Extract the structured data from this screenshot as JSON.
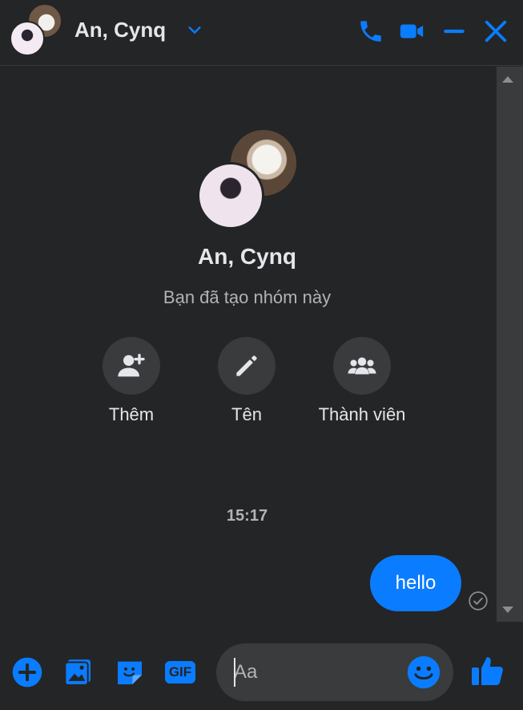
{
  "header": {
    "title": "An, Cynq",
    "icons": [
      "chevron-down-icon",
      "phone-icon",
      "video-icon",
      "minimize-icon",
      "close-icon"
    ],
    "accent_color": "#0a7cff"
  },
  "intro": {
    "group_name": "An, Cynq",
    "subtitle": "Bạn đã tạo nhóm này",
    "actions": [
      {
        "label": "Thêm",
        "icon": "add-person-icon"
      },
      {
        "label": "Tên",
        "icon": "pencil-icon"
      },
      {
        "label": "Thành viên",
        "icon": "group-icon"
      }
    ]
  },
  "messages": {
    "timestamp": "15:17",
    "items": [
      {
        "text": "hello",
        "from": "me",
        "status": "seen-check-icon"
      }
    ]
  },
  "composer": {
    "placeholder": "Aa",
    "value": "",
    "icons": [
      "plus-icon",
      "photo-icon",
      "sticker-icon",
      "gif-icon",
      "emoji-icon",
      "like-icon"
    ],
    "gif_label": "GIF"
  },
  "colors": {
    "background": "#242526",
    "bubble": "#0a7cff",
    "surface": "#3a3b3c"
  }
}
